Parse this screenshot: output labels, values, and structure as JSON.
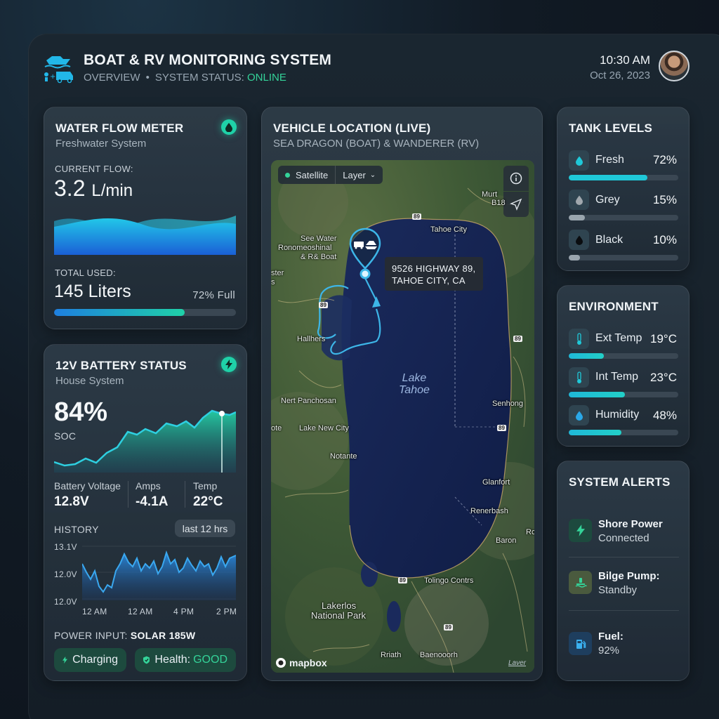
{
  "header": {
    "title": "BOAT & RV MONITORING SYSTEM",
    "tab": "OVERVIEW",
    "status_label": "SYSTEM STATUS:",
    "status_value": "ONLINE",
    "time": "10:30 AM",
    "date": "Oct 26, 2023"
  },
  "water": {
    "title": "WATER FLOW METER",
    "subtitle": "Freshwater System",
    "flow_label": "CURRENT FLOW:",
    "flow_value": "3.2",
    "flow_unit": "L/min",
    "total_label": "TOTAL USED:",
    "total_value": "145 Liters",
    "fill_text": "72% Full",
    "fill_fraction": 0.72,
    "icon": "droplet-icon"
  },
  "battery": {
    "title": "12V BATTERY STATUS",
    "subtitle": "House System",
    "soc_value": "84%",
    "soc_label": "SOC",
    "voltage_label": "Battery Voltage",
    "voltage_value": "12.8V",
    "amps_label": "Amps",
    "amps_value": "-4.1A",
    "temp_label": "Temp",
    "temp_value": "22°C",
    "history_label": "HISTORY",
    "history_range": "last 12 hrs",
    "history_y_ticks": [
      "13.1V",
      "12.0V",
      "12.0V"
    ],
    "history_x_ticks": [
      "12 AM",
      "12 AM",
      "4 PM",
      "2 PM"
    ],
    "power_label": "POWER INPUT:",
    "power_value": "SOLAR 185W",
    "charging_label": "Charging",
    "health_label": "Health:",
    "health_value": "GOOD",
    "icon": "bolt-icon"
  },
  "map": {
    "title": "VEHICLE LOCATION (LIVE)",
    "subtitle": "SEA DRAGON (BOAT) & WANDERER (RV)",
    "mode_label": "Satellite",
    "layer_label": "Layer",
    "address_line1": "9526 HIGHWAY 89,",
    "address_line2": "TAHOE CITY, CA",
    "lake_name_line1": "Lake",
    "lake_name_line2": "Tahoe",
    "brand": "mapbox",
    "layer_tag": "Laver",
    "places": {
      "p1": "Tahoe City",
      "p2": "See Water",
      "p3": "Ronomeoshinal",
      "p4": "& R& Boat",
      "p5": "Murt",
      "p6": "B18",
      "p7": "ster",
      "p8": "s",
      "p9": "Hallhers",
      "p10": "Nert Panchosan",
      "p11": "ote",
      "p12": "Lake New City",
      "p13": "Notante",
      "p14": "Senhong",
      "p15": "Glanfort",
      "p16": "Renerbash",
      "p17": "Baron",
      "p18": "Tolingo Contrs",
      "p19": "Lakerlos",
      "p20": "National Park",
      "p21": "Rriath",
      "p22": "Baenooorh",
      "p23": "Rc"
    },
    "shields": {
      "s1": "89",
      "s2": "89",
      "s3": "89",
      "s4": "89",
      "s5": "89",
      "s6": "89"
    }
  },
  "tanks": {
    "title": "TANK LEVELS",
    "items": [
      {
        "label": "Fresh",
        "value": "72%",
        "fraction": 0.72,
        "color": "#1fc8d8"
      },
      {
        "label": "Grey",
        "value": "15%",
        "fraction": 0.15,
        "color": "#9aa5ae"
      },
      {
        "label": "Black",
        "value": "10%",
        "fraction": 0.1,
        "color": "#9aa5ae"
      }
    ]
  },
  "environment": {
    "title": "ENVIRONMENT",
    "items": [
      {
        "label": "Ext Temp",
        "value": "19°C",
        "fraction": 0.32
      },
      {
        "label": "Int Temp",
        "value": "23°C",
        "fraction": 0.51
      },
      {
        "label": "Humidity",
        "value": "48%",
        "fraction": 0.48
      }
    ]
  },
  "alerts": {
    "title": "SYSTEM ALERTS",
    "items": [
      {
        "title": "Shore Power",
        "sub": "Connected",
        "icon": "bolt-icon"
      },
      {
        "title": "Bilge Pump:",
        "sub": "Standby",
        "icon": "pump-icon"
      },
      {
        "title": "Fuel:",
        "sub": "92%",
        "icon": "fuel-pump-icon"
      }
    ]
  },
  "colors": {
    "accent": "#1fd1a8",
    "online": "#34d399",
    "water": "#1e7fe0",
    "lake": "#14234f"
  }
}
